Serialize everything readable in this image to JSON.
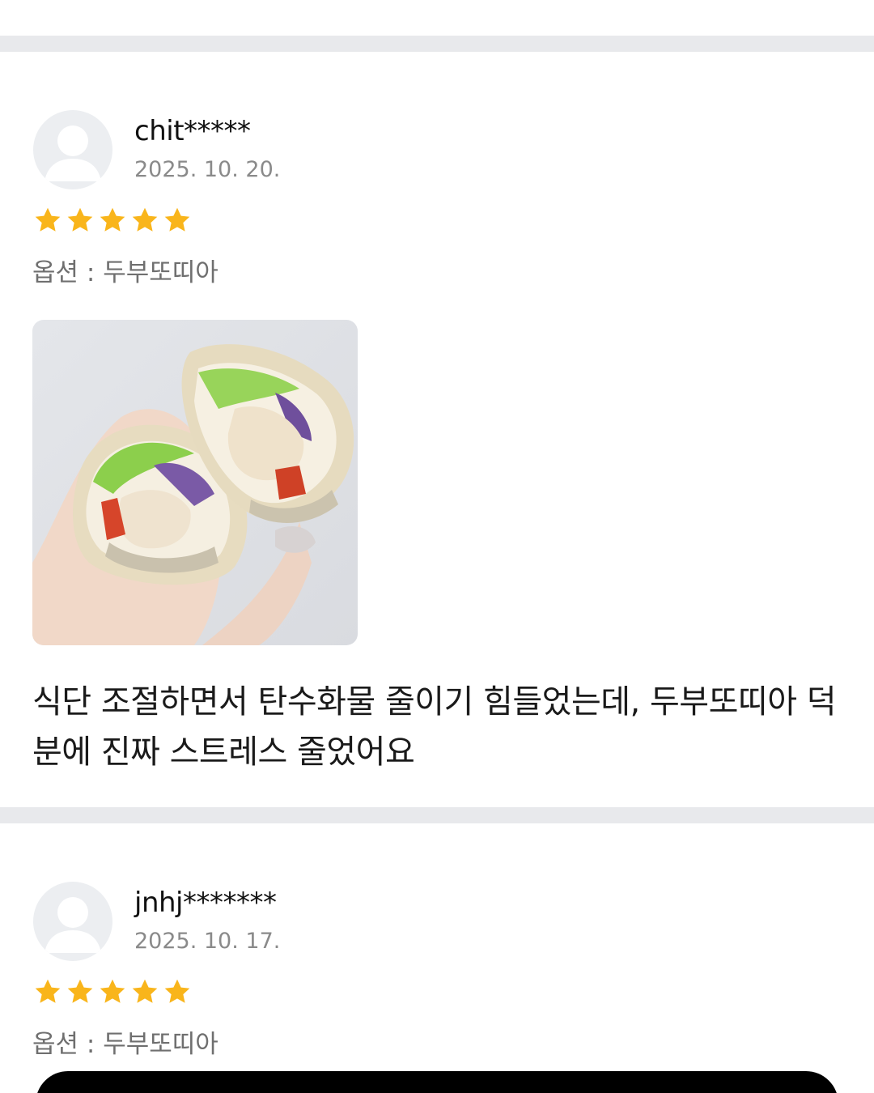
{
  "reviews": [
    {
      "username": "chit*****",
      "date": "2025. 10. 20.",
      "rating": 5,
      "option": "옵션 : 두부또띠아",
      "has_photo": true,
      "text": "식단 조절하면서 탄수화물 줄이기 힘들었는데, 두부또띠아 덕분에 진짜 스트레스 줄었어요"
    },
    {
      "username": "jnhj*******",
      "date": "2025. 10. 17.",
      "rating": 5,
      "option": "옵션 : 두부또띠아"
    }
  ],
  "icons": {
    "avatar": "user-placeholder-icon",
    "star": "star-icon"
  },
  "colors": {
    "star": "#f9b51b",
    "divider": "#e8e9ec",
    "avatar_bg": "#eceef1",
    "avatar_fg": "#ffffff"
  }
}
